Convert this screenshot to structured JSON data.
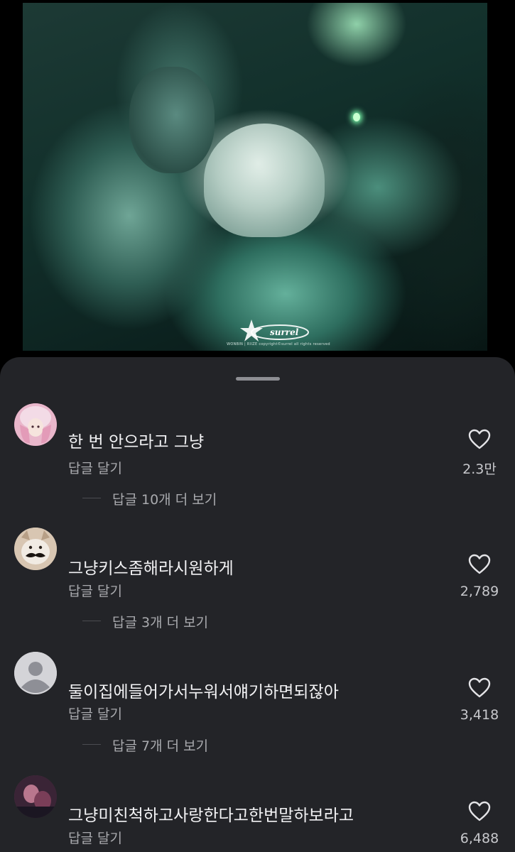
{
  "photo": {
    "watermark_logo": "surrel",
    "watermark_caption": "WONBIN | RIIZE  copyright©surrel  all rights reserved"
  },
  "comments": [
    {
      "avatar": "pink-hair-avatar",
      "text": "한 번 안으라고 그냥",
      "reply_label": "답글 달기",
      "likes": "2.3만",
      "more_replies": "답글 10개 더 보기"
    },
    {
      "avatar": "mustache-cat-avatar",
      "text": "그냥키스좀해라시원하게",
      "reply_label": "답글 달기",
      "likes": "2,789",
      "more_replies": "답글 3개 더 보기"
    },
    {
      "avatar": "default-user-avatar",
      "text": "둘이집에들어가서누워서얘기하면되잖아",
      "reply_label": "답글 달기",
      "likes": "3,418",
      "more_replies": "답글 7개 더 보기"
    },
    {
      "avatar": "photo-avatar",
      "text": "그냥미친척하고사랑한다고한번말하보라고",
      "reply_label": "답글 달기",
      "likes": "6,488"
    }
  ],
  "colors": {
    "sheet_background": "#232428",
    "primary_text": "#f2f2f4",
    "secondary_text": "#a9aaae",
    "heart_outline": "#e4e4e7"
  }
}
